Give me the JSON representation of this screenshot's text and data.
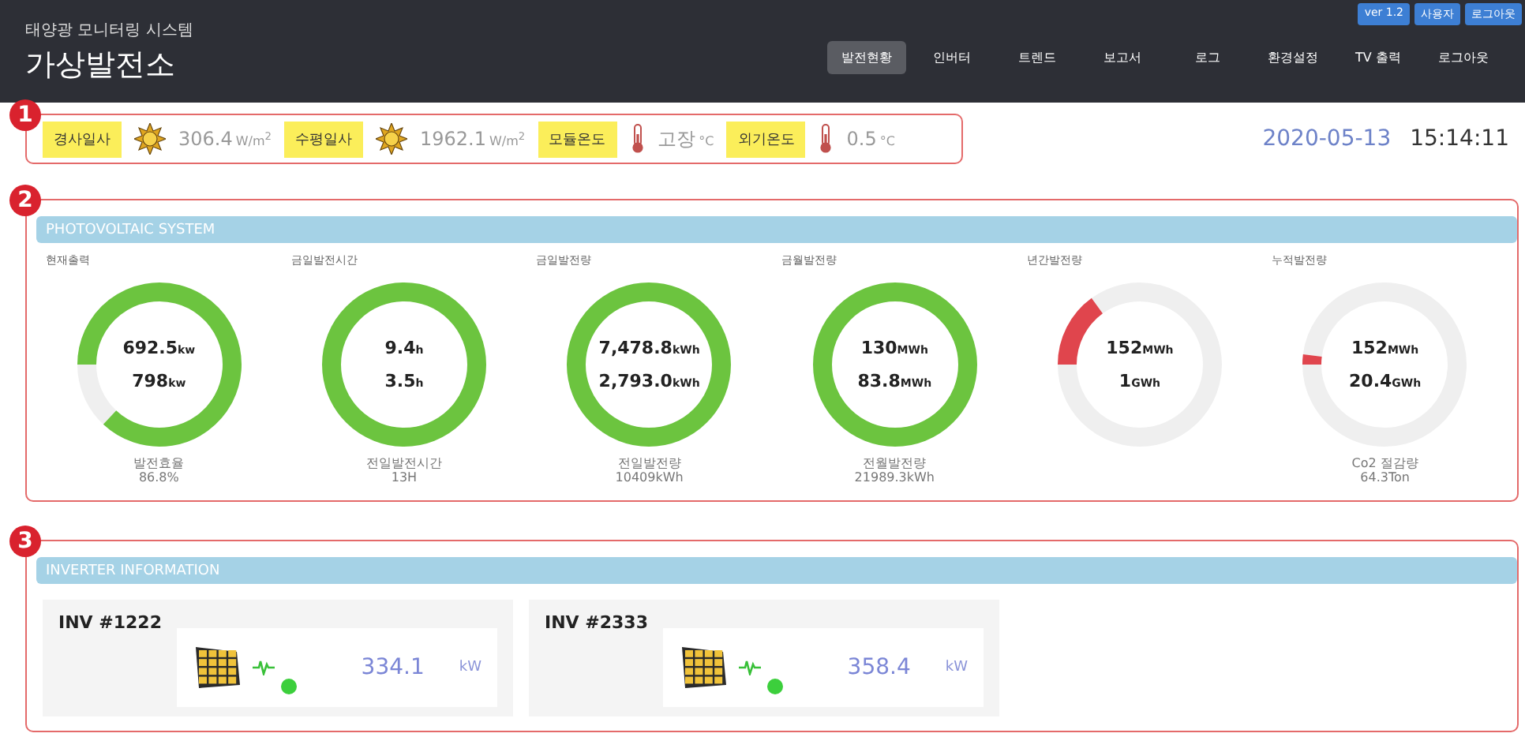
{
  "header": {
    "subtitle": "태양광 모니터링 시스템",
    "title": "가상발전소",
    "badges": [
      "ver 1.2",
      "사용자",
      "로그아웃"
    ],
    "nav": [
      {
        "label": "발전현황",
        "selected": true
      },
      {
        "label": "인버터",
        "selected": false
      },
      {
        "label": "트렌드",
        "selected": false
      },
      {
        "label": "보고서",
        "selected": false
      },
      {
        "label": "로그",
        "selected": false
      },
      {
        "label": "환경설정",
        "selected": false
      },
      {
        "label": "TV 출력",
        "selected": false
      },
      {
        "label": "로그아웃",
        "selected": false
      }
    ]
  },
  "weather": {
    "badge": "1",
    "items": [
      {
        "label": "경사일사",
        "kind": "sun",
        "value": "306.4",
        "unit": "W/m$^{2}$"
      },
      {
        "label": "수평일사",
        "kind": "sun",
        "value": "1962.1",
        "unit": "W/m$^{2}$"
      },
      {
        "label": "모듈온도",
        "kind": "temp",
        "value": "고장",
        "unit": "°C"
      },
      {
        "label": "외기온도",
        "kind": "temp",
        "value": "0.5",
        "unit": "°C"
      }
    ],
    "date": "2020-05-13",
    "time": "15:14:11"
  },
  "pv": {
    "badge": "2",
    "title": "PHOTOVOLTAIC SYSTEM",
    "gauges": [
      {
        "title": "현재출력",
        "color": "#6cc43f",
        "value1": "692.5",
        "unit1": "kw",
        "value2": "798",
        "unit2": "kw",
        "caption": "발전효율",
        "caption_value": "86.8%"
      },
      {
        "title": "금일발전시간",
        "color": "#6cc43f",
        "value1": "9.4",
        "unit1": "h",
        "value2": "3.5",
        "unit2": "h",
        "caption": "전일발전시간",
        "caption_value": "13H"
      },
      {
        "title": "금일발전량",
        "color": "#6cc43f",
        "value1": "7,478.8",
        "unit1": "kWh",
        "value2": "2,793.0",
        "unit2": "kWh",
        "caption": "전일발전량",
        "caption_value": "10409kWh"
      },
      {
        "title": "금월발전량",
        "color": "#6cc43f",
        "value1": "130",
        "unit1": "MWh",
        "value2": "83.8",
        "unit2": "MWh",
        "caption": "전월발전량",
        "caption_value": "21989.3kWh"
      },
      {
        "title": "년간발전량",
        "color": "#e0454d",
        "value1": "152",
        "unit1": "MWh",
        "value2": "1",
        "unit2": "GWh"
      },
      {
        "title": "누적발전량",
        "color": "#e0454d",
        "value1": "152",
        "unit1": "MWh",
        "value2": "20.4",
        "unit2": "GWh",
        "caption": "Co2 절감량",
        "caption_value": "64.3Ton"
      }
    ]
  },
  "inverters": {
    "badge": "3",
    "title": "INVERTER INFORMATION",
    "items": [
      {
        "name": "INV #1222",
        "value": "334.1",
        "unit": "kW",
        "color": "#3ccf3c"
      },
      {
        "name": "INV #2333",
        "value": "358.4",
        "unit": "kW",
        "color": "#3ccf3c"
      }
    ]
  }
}
